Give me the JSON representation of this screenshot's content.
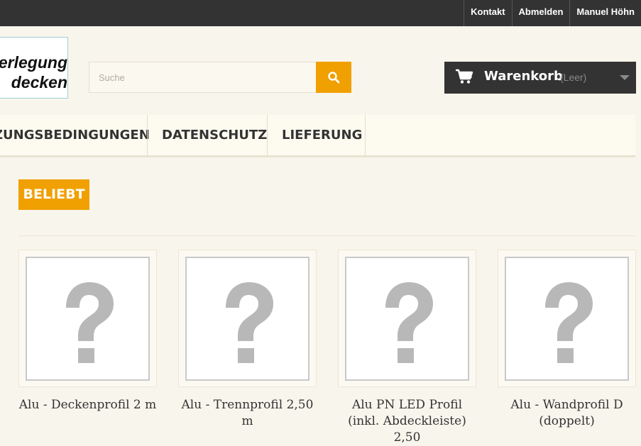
{
  "topnav": {
    "items": [
      "Kontakt",
      "Abmelden",
      "Manuel Höhn"
    ]
  },
  "logo": {
    "line1": "erlegung",
    "line2": "decken"
  },
  "search": {
    "placeholder": "Suche"
  },
  "cart": {
    "label": "Warenkorb",
    "status": "(Leer)"
  },
  "menu": {
    "items": [
      "ZUNGSBEDINGUNGEN",
      "DATENSCHUTZ",
      "LIEFERUNG"
    ]
  },
  "section": {
    "badge": "BELIEBT"
  },
  "products": [
    {
      "name": "Alu - Deckenprofil 2 m"
    },
    {
      "name": "Alu - Trennprofil 2,50 m"
    },
    {
      "name": "Alu PN LED Profil (inkl. Abdeckleiste) 2,50"
    },
    {
      "name": "Alu - Wandprofil D (doppelt)"
    }
  ],
  "colors": {
    "accent": "#f0a000",
    "dark": "#333333",
    "background": "#f8f5ec"
  }
}
